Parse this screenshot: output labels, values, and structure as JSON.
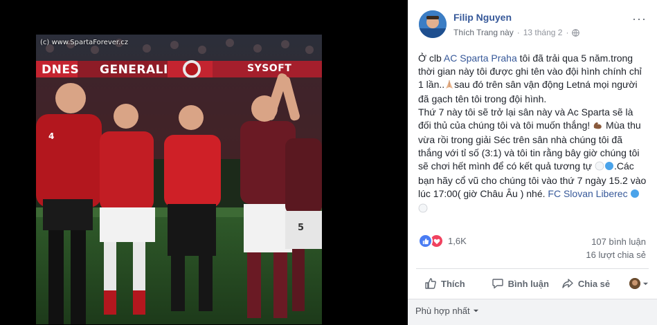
{
  "photo": {
    "watermark": "(c) www.SpartaForever.cz",
    "banner_left": "DNES",
    "banner_mid": "GENERALI",
    "banner_right": "SYSOFT",
    "jersey_number_left": "4",
    "jersey_number_right": "5"
  },
  "post": {
    "author": "Filip Nguyen",
    "like_page": "Thích Trang này",
    "separator": "·",
    "date": "13 tháng 2",
    "more_label": "···",
    "text": {
      "p1_before_link": "Ở clb ",
      "p1_link": "AC Sparta Praha",
      "p1_after_link": " tôi đã trải qua 5 năm.trong thời gian này tôi được ghi tên vào đội hình chính chỉ 1 lần..",
      "p1_after_emoji": "sau đó trên sân vận động Letná mọi người đã gạch tên tôi trong đội hình.",
      "p2_before_emoji": "Thứ 7 này tôi sẽ trở lại sân này và Ac Sparta sẽ là đối thủ của chúng tôi và tôi muốn thắng! ",
      "p2_after_emoji": " Mùa thu vừa rồi trong giải Séc trên sân nhà chúng tôi đã thắng với tỉ số (3:1) và tôi tin rằng bây giờ chúng tôi sẽ chơi hết mình để có kết quả tương tự ",
      "p2_after_circles": ".Các bạn hãy cổ vũ cho chúng tôi vào thứ 7 ngày 15.2 vào lúc 17:00( giờ Châu Âu ) nhé. ",
      "p2_link": "FC Slovan Liberec",
      "emoji_pray": "pray-emoji",
      "emoji_muscle": "muscle-emoji"
    },
    "reactions": {
      "count": "1,6K",
      "types": [
        "like",
        "love"
      ]
    },
    "comments_count": "107 bình luận",
    "shares_count": "16 lượt chia sẻ",
    "actions": {
      "like": "Thích",
      "comment": "Bình luận",
      "share": "Chia sẻ"
    },
    "sort_label": "Phù hợp nhất"
  },
  "colors": {
    "link": "#365899",
    "meta": "#90949c",
    "action": "#606770",
    "like_blue": "#4a7cf3",
    "love_red": "#f0425f",
    "sparta_red": "#b3171e",
    "sparta_maroon": "#6a1a24"
  },
  "icons": {
    "public": "globe-icon",
    "more": "ellipsis-icon",
    "like": "thumbs-up-icon",
    "comment": "speech-bubble-icon",
    "share": "share-arrow-icon",
    "sort": "caret-down-icon"
  }
}
